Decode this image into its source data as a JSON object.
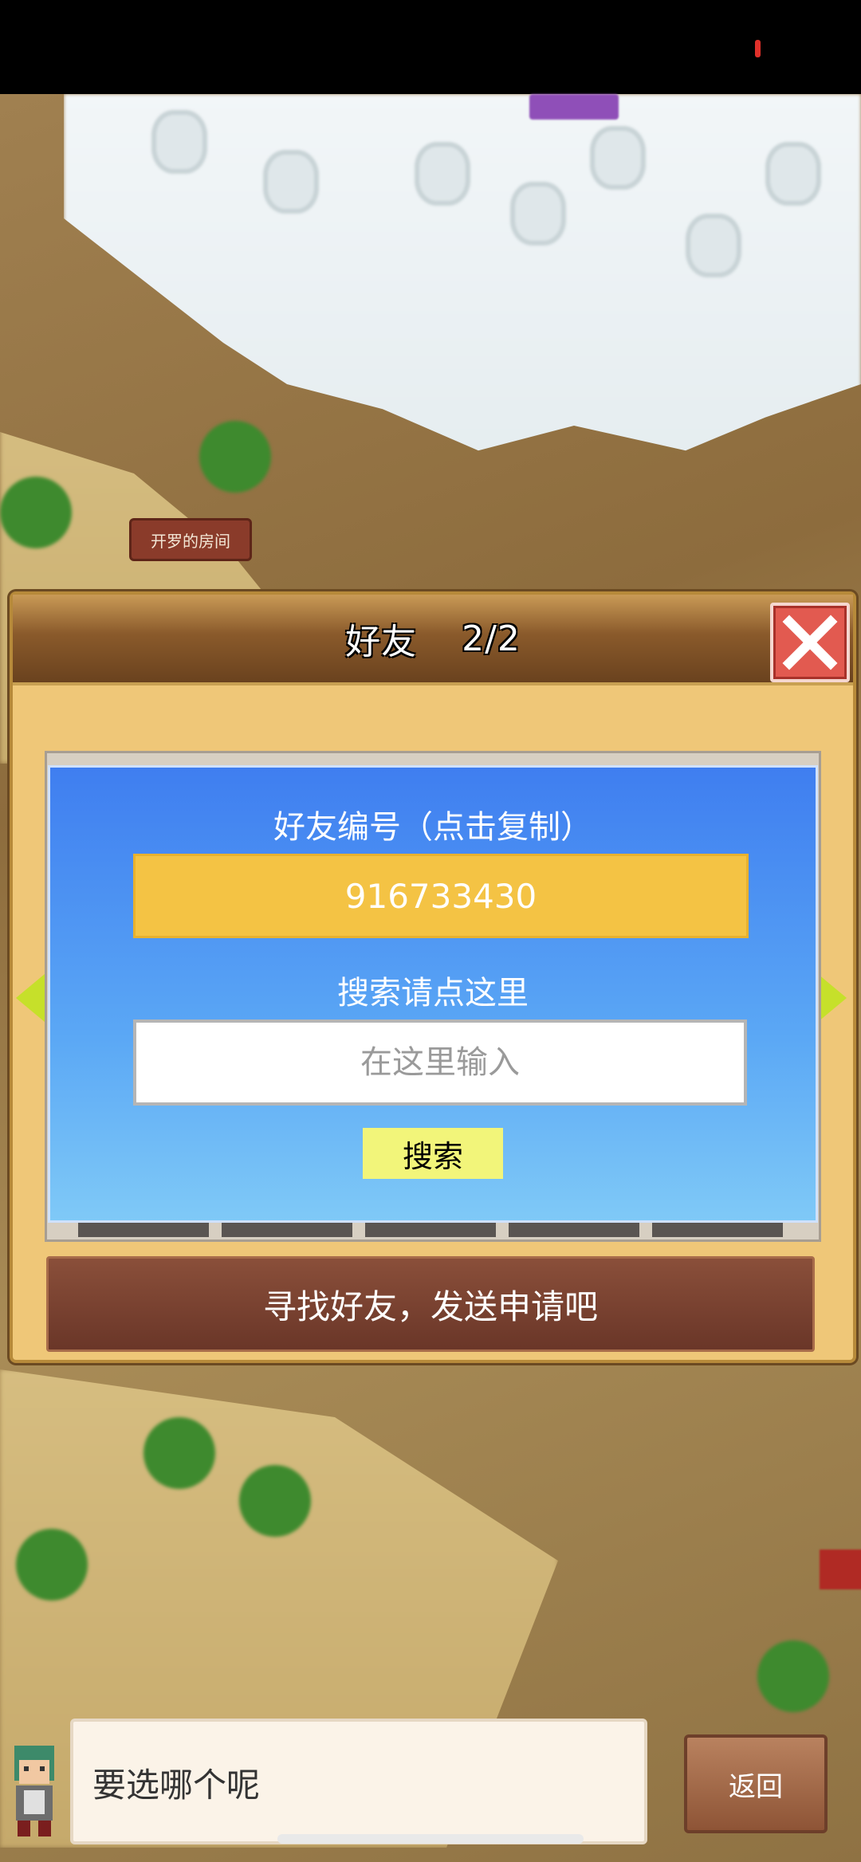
{
  "map": {
    "room_label": "开罗的房间"
  },
  "dialog": {
    "title": "好友",
    "page_indicator": "2/2",
    "friend_id_label": "好友编号（点击复制）",
    "friend_id": "916733430",
    "search_label": "搜索请点这里",
    "search_placeholder": "在这里输入",
    "search_button": "搜索",
    "send_request_label": "寻找好友，发送申请吧"
  },
  "bottom": {
    "message": "要选哪个呢",
    "back_button": "返回"
  },
  "colors": {
    "panel_blue": "#3f7ef0",
    "id_field_yellow": "#f4c344",
    "search_button_yellow": "#f2f57a",
    "close_button_red": "#e25a50",
    "arrow_green": "#c6e02a"
  }
}
